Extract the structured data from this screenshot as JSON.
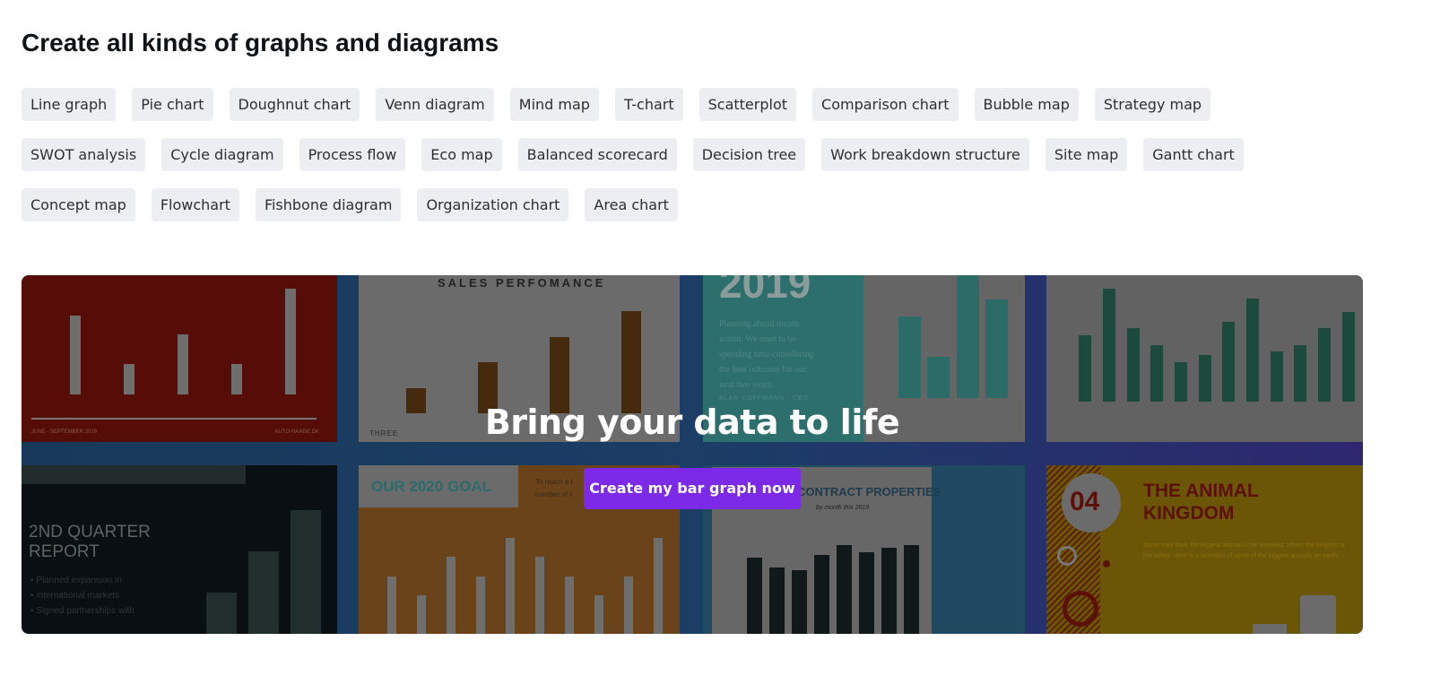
{
  "heading": "Create all kinds of graphs and diagrams",
  "chips": [
    "Line graph",
    "Pie chart",
    "Doughnut chart",
    "Venn diagram",
    "Mind map",
    "T-chart",
    "Scatterplot",
    "Comparison chart",
    "Bubble map",
    "Strategy map",
    "SWOT analysis",
    "Cycle diagram",
    "Process flow",
    "Eco map",
    "Balanced scorecard",
    "Decision tree",
    "Work breakdown structure",
    "Site map",
    "Gantt chart",
    "Concept map",
    "Flowchart",
    "Fishbone diagram",
    "Organization chart",
    "Area chart"
  ],
  "banner": {
    "headline": "Bring your data to life",
    "cta_label": "Create my bar graph now",
    "cta_color": "#7d2ae8",
    "thumbnails": {
      "sales_title": "SALES PERFOMANCE",
      "sales_footer": "THREE",
      "year": "2019",
      "teal_text": "Planning ahead means action. We need to be spending time considering the best outcome for our next two years.",
      "teal_author": "ALAN COFFMANN - CEO",
      "quarter_title": "2ND QUARTER REPORT",
      "quarter_bullets": "• Planned expansion in\n• international markets\n• Signed partnerships with",
      "goal_title": "OUR 2020 GOAL",
      "goal_text": "To reach a t\nnumber of c",
      "contract_title": "R CONTRACT PROPERTIES",
      "contract_subtitle": "by month this 2019",
      "animal_number": "04",
      "animal_title": "THE ANIMAL KINGDOM",
      "animal_text": "Some may think the biggest animal is the heaviest, others the longest, or the tallest. Here is a selection of some of the biggest animals on earth.",
      "red_footer_left": "JUNE - SEPTEMBER 2019",
      "red_footer_right": "AUTO-HAAGE.DK"
    }
  }
}
